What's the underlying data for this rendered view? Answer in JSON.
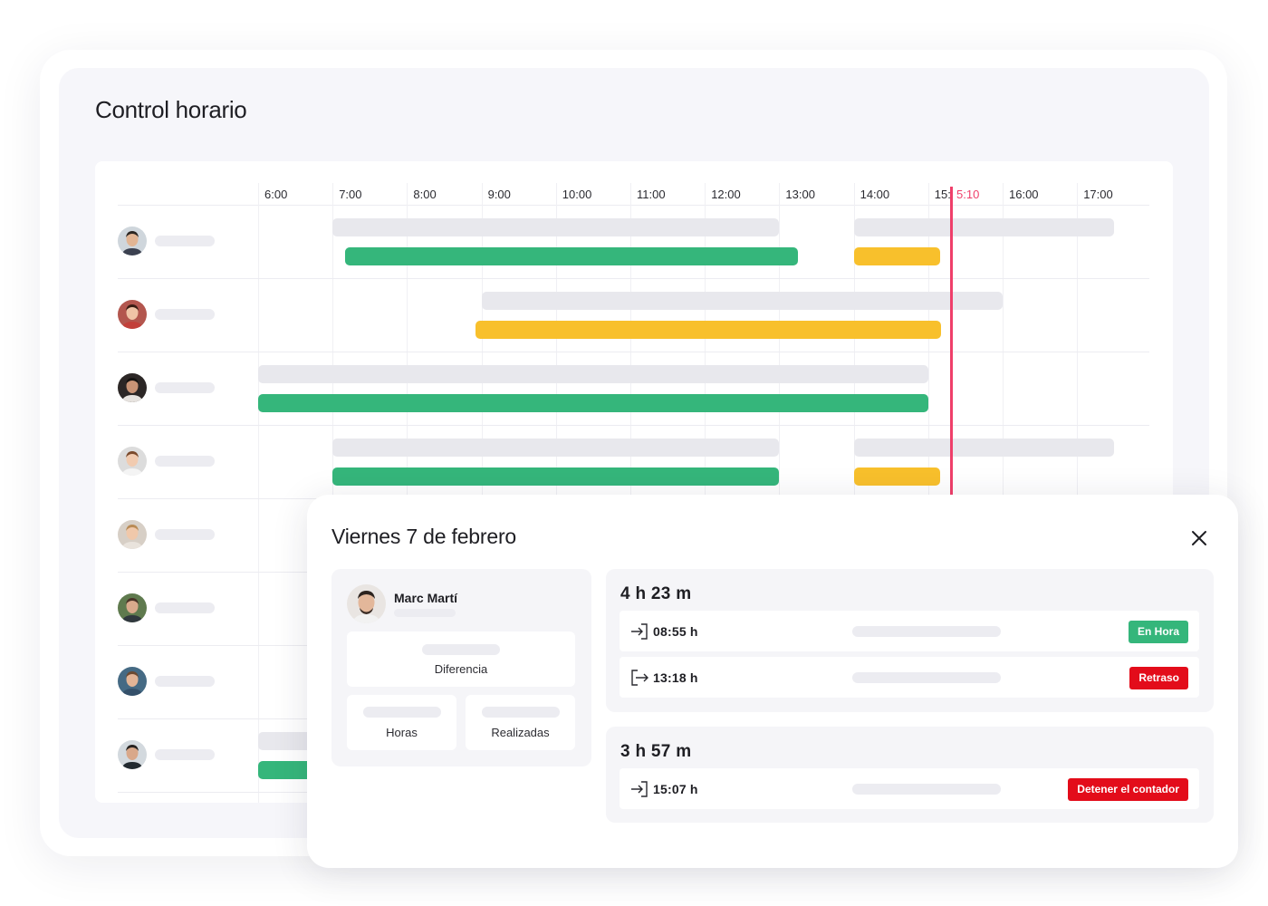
{
  "page": {
    "title": "Control horario"
  },
  "timeline": {
    "hours": [
      "6:00",
      "7:00",
      "8:00",
      "9:00",
      "10:00",
      "11:00",
      "12:00",
      "13:00",
      "14:00",
      "15:",
      "16:00",
      "17:00"
    ],
    "current_time_label": "5:10",
    "current_time": "15:10",
    "colors": {
      "planned": "#e8e8ed",
      "on_time": "#35b67b",
      "late": "#f8c02c",
      "now_marker": "#ef3f6a"
    },
    "rows": [
      {
        "avatar": "avatar-man-1",
        "planned": [
          [
            "7:00",
            "13:00"
          ],
          [
            "14:00",
            "17:30"
          ]
        ],
        "worked": [
          [
            "7:10",
            "13:15",
            "on_time"
          ],
          [
            "14:00",
            "15:10",
            "late"
          ]
        ]
      },
      {
        "avatar": "avatar-woman-1",
        "planned": [
          [
            "9:00",
            "16:00"
          ]
        ],
        "worked": [
          [
            "8:55",
            "15:10",
            "late"
          ]
        ]
      },
      {
        "avatar": "avatar-man-2",
        "planned": [
          [
            "6:00",
            "15:00"
          ]
        ],
        "worked": [
          [
            "6:00",
            "15:00",
            "on_time"
          ]
        ]
      },
      {
        "avatar": "avatar-woman-2",
        "planned": [
          [
            "7:00",
            "13:00"
          ],
          [
            "14:00",
            "17:30"
          ]
        ],
        "worked": [
          [
            "7:00",
            "13:00",
            "on_time"
          ],
          [
            "14:00",
            "15:10",
            "late"
          ]
        ]
      },
      {
        "avatar": "avatar-woman-3",
        "planned": [],
        "worked": []
      },
      {
        "avatar": "avatar-man-3",
        "planned": [],
        "worked": []
      },
      {
        "avatar": "avatar-man-4",
        "planned": [],
        "worked": []
      },
      {
        "avatar": "avatar-man-5",
        "planned": [
          [
            "6:00",
            "7:00"
          ]
        ],
        "worked": [
          [
            "6:00",
            "7:00",
            "on_time"
          ]
        ]
      }
    ]
  },
  "modal": {
    "title": "Viernes 7 de febrero",
    "employee": {
      "name": "Marc Martí",
      "stats": {
        "difference": "Diferencia",
        "hours": "Horas",
        "done": "Realizadas"
      }
    },
    "sessions": [
      {
        "total": "4 h 23 m",
        "punches": [
          {
            "icon": "clock-in-icon",
            "time": "08:55 h",
            "badge": "En Hora",
            "badge_type": "ok"
          },
          {
            "icon": "clock-out-icon",
            "time": "13:18 h",
            "badge": "Retraso",
            "badge_type": "late"
          }
        ]
      },
      {
        "total": "3 h 57 m",
        "punches": [
          {
            "icon": "clock-in-icon",
            "time": "15:07 h",
            "badge": "Detener el contador",
            "badge_type": "stop"
          }
        ]
      }
    ]
  }
}
